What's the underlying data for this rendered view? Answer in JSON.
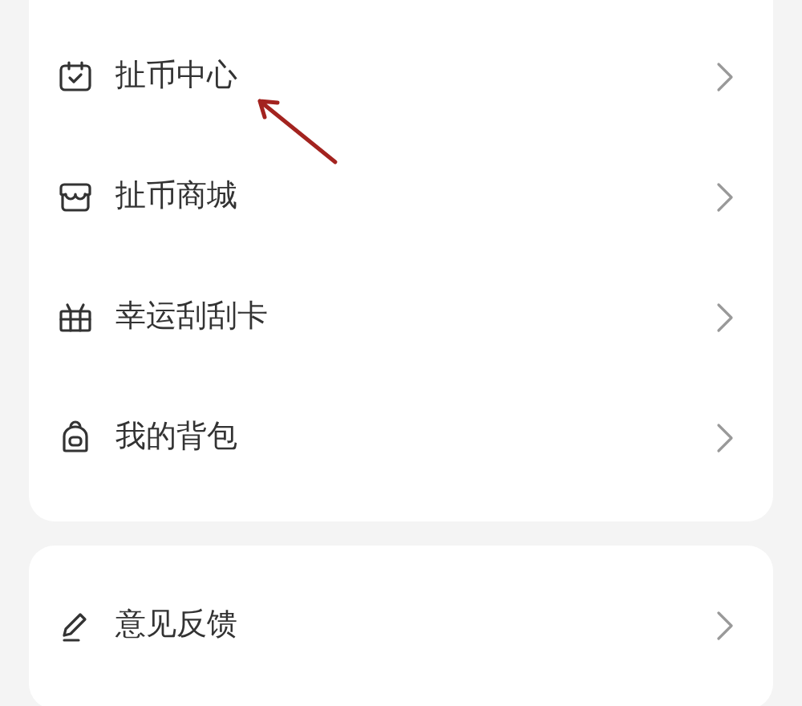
{
  "menu_groups": [
    {
      "items": [
        {
          "label": "扯币中心"
        },
        {
          "label": "扯币商城"
        },
        {
          "label": "幸运刮刮卡"
        },
        {
          "label": "我的背包"
        }
      ]
    },
    {
      "items": [
        {
          "label": "意见反馈"
        }
      ]
    }
  ]
}
